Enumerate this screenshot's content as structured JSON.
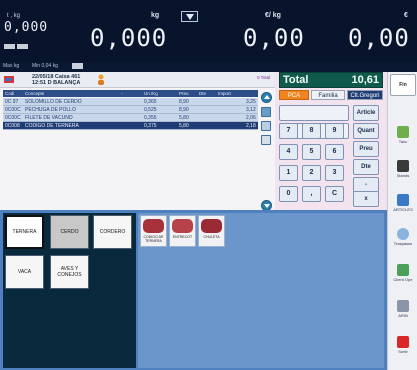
{
  "display": {
    "tare_label": "t , kg",
    "tare_value": "0,000",
    "weight_unit": "kg",
    "weight_value": "0,000",
    "price_unit": "€/ kg",
    "price_value": "0,00",
    "amount_unit": "€",
    "amount_value": "0,00"
  },
  "subbar": {
    "left": "Max kg",
    "mid": "Min 0,04 kg"
  },
  "ticket": {
    "date_line": "22/05/18  Caixa 461",
    "time_line": "12:51  D BALANÇA",
    "total_side": "0 Total",
    "columns": [
      "Codi",
      "Concepte",
      "Un./Kg",
      "Preu",
      "Dte",
      "Import"
    ],
    "rows": [
      {
        "code": "0C 97",
        "name": "SOLOMILLO DE CERDO",
        "qty": "0,365",
        "price": "8,90",
        "disc": "",
        "amount": "3,25",
        "selected": false
      },
      {
        "code": "0C00C",
        "name": "PECHUGA DE POLLO",
        "qty": "0,525",
        "price": "8,90",
        "disc": "",
        "amount": "3,12",
        "selected": false
      },
      {
        "code": "0C00C",
        "name": "FILETE DE VACUNO",
        "qty": "0,355",
        "price": "5,80",
        "disc": "",
        "amount": "2,06",
        "selected": false
      },
      {
        "code": "0C008",
        "name": "CODIGO DE TERNERA",
        "qty": "0,375",
        "price": "5,80",
        "disc": "",
        "amount": "2,18",
        "selected": true
      }
    ]
  },
  "total": {
    "label": "Total",
    "value": "10,61",
    "modes": [
      "PCA",
      "Familia",
      "Clt.Gregori"
    ]
  },
  "keypad": {
    "article": "Article",
    "quant": "Quant",
    "preu": "Preu",
    "dte": "Dte",
    "keys": [
      "7",
      "8",
      "9",
      "4",
      "5",
      "6",
      "1",
      "2",
      "3",
      "0",
      ",",
      "C"
    ],
    "minus": "-",
    "times": "x"
  },
  "rightbar": {
    "fin": "Fin",
    "items": [
      "Tanc",
      "Stands",
      "ARTICLES",
      "Traspasso",
      "Client Ope",
      "ARIN",
      "Sortir"
    ]
  },
  "categories": [
    {
      "label": "TERNERA",
      "style": "sel"
    },
    {
      "label": "CERDO",
      "style": "grey"
    },
    {
      "label": "CORDERO",
      "style": "white"
    },
    {
      "label": "VACA",
      "style": "white"
    },
    {
      "label": "AVES Y CONEJOS",
      "style": "white"
    }
  ],
  "products": [
    {
      "label": "CODIGO DE TERNERA"
    },
    {
      "label": "ENTRECOT"
    },
    {
      "label": "CHULETA"
    }
  ],
  "colors": {
    "display_bg": "#08142c",
    "accent_orange": "#f0851f",
    "total_green": "#0f5a4c",
    "grid_header": "#2c4d87",
    "product_bg": "#6b96cc"
  }
}
